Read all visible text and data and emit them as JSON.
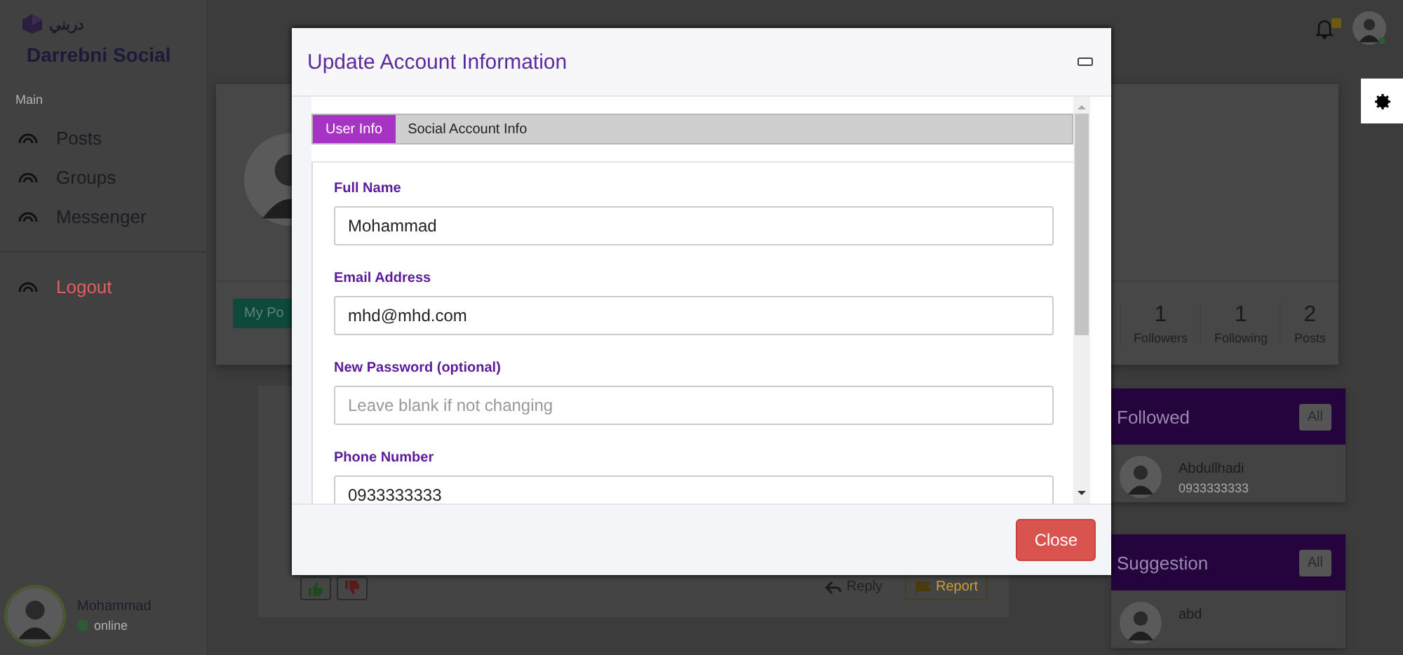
{
  "brand": {
    "logo_text": "دربني",
    "title": "Darrebni Social"
  },
  "sidebar": {
    "section": "Main",
    "items": [
      {
        "label": "Posts",
        "kind": "nav"
      },
      {
        "label": "Groups",
        "kind": "nav"
      },
      {
        "label": "Messenger",
        "kind": "nav"
      },
      {
        "label": "Logout",
        "kind": "logout"
      }
    ],
    "user": {
      "name": "Mohammad",
      "status": "online"
    }
  },
  "profile": {
    "posts_button": "My Po",
    "stats": [
      {
        "value": "1",
        "label": "Followers"
      },
      {
        "value": "1",
        "label": "Following"
      },
      {
        "value": "2",
        "label": "Posts"
      }
    ]
  },
  "post": {
    "reply": "Reply",
    "report": "Report"
  },
  "followed": {
    "title": "Followed",
    "all_button": "All",
    "items": [
      {
        "name": "Abdullhadi",
        "phone": "0933333333"
      }
    ]
  },
  "suggestion": {
    "title": "Suggestion",
    "all_button": "All",
    "items": [
      {
        "name": "abd"
      }
    ]
  },
  "modal": {
    "title": "Update Account Information",
    "tabs": [
      {
        "label": "User Info",
        "selected": true
      },
      {
        "label": "Social Account Info",
        "selected": false
      }
    ],
    "fields": [
      {
        "label": "Full Name",
        "value": "Mohammad"
      },
      {
        "label": "Email Address",
        "value": "mhd@mhd.com"
      },
      {
        "label": "New Password (optional)",
        "placeholder": "Leave blank if not changing"
      },
      {
        "label": "Phone Number",
        "value": "0933333333"
      }
    ],
    "close_button": "Close"
  }
}
